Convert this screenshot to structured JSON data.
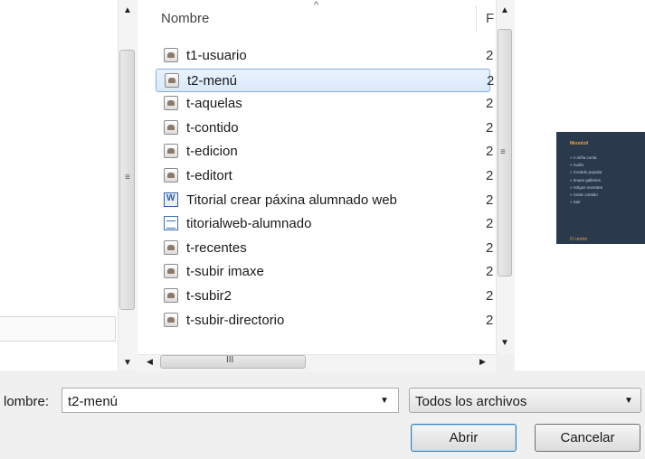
{
  "list": {
    "column_name": "Nombre",
    "column_second_letter": "F",
    "files": [
      {
        "name": "t1-usuario",
        "icon": "image-file-icon",
        "col": "2"
      },
      {
        "name": "t2-menú",
        "icon": "image-file-icon",
        "col": "2",
        "selected": true
      },
      {
        "name": "t-aquelas",
        "icon": "image-file-icon",
        "col": "2"
      },
      {
        "name": "t-contido",
        "icon": "image-file-icon",
        "col": "2"
      },
      {
        "name": "t-edicion",
        "icon": "image-file-icon",
        "col": "2"
      },
      {
        "name": "t-editort",
        "icon": "image-file-icon",
        "col": "2"
      },
      {
        "name": "Titorial crear páxina alumnado web",
        "icon": "word-document-icon",
        "col": "2"
      },
      {
        "name": "titorialweb-alumnado",
        "icon": "text-document-icon",
        "col": "2"
      },
      {
        "name": "t-recentes",
        "icon": "image-file-icon",
        "col": "2"
      },
      {
        "name": "t-subir imaxe",
        "icon": "image-file-icon",
        "col": "2"
      },
      {
        "name": "t-subir2",
        "icon": "image-file-icon",
        "col": "2"
      },
      {
        "name": "t-subir-directorio",
        "icon": "image-file-icon",
        "col": "2"
      }
    ]
  },
  "preview": {
    "title": "Menololi",
    "items": [
      "» A miña conta",
      "» Audio",
      "» Contido popular",
      "» Imaxe galleries",
      "» Artigos recentes",
      "» Crear contido",
      "» Sair"
    ],
    "footer": "O centro"
  },
  "footer": {
    "name_label": "lombre:",
    "name_value": "t2-menú",
    "filetype": "Todos los archivos",
    "open_label": "Abrir",
    "cancel_label": "Cancelar"
  },
  "colors": {
    "selection_bg": "#d9e9fb",
    "selection_border": "#84acdd",
    "preview_bg": "#2a3a4c",
    "preview_accent": "#e3a24a"
  }
}
